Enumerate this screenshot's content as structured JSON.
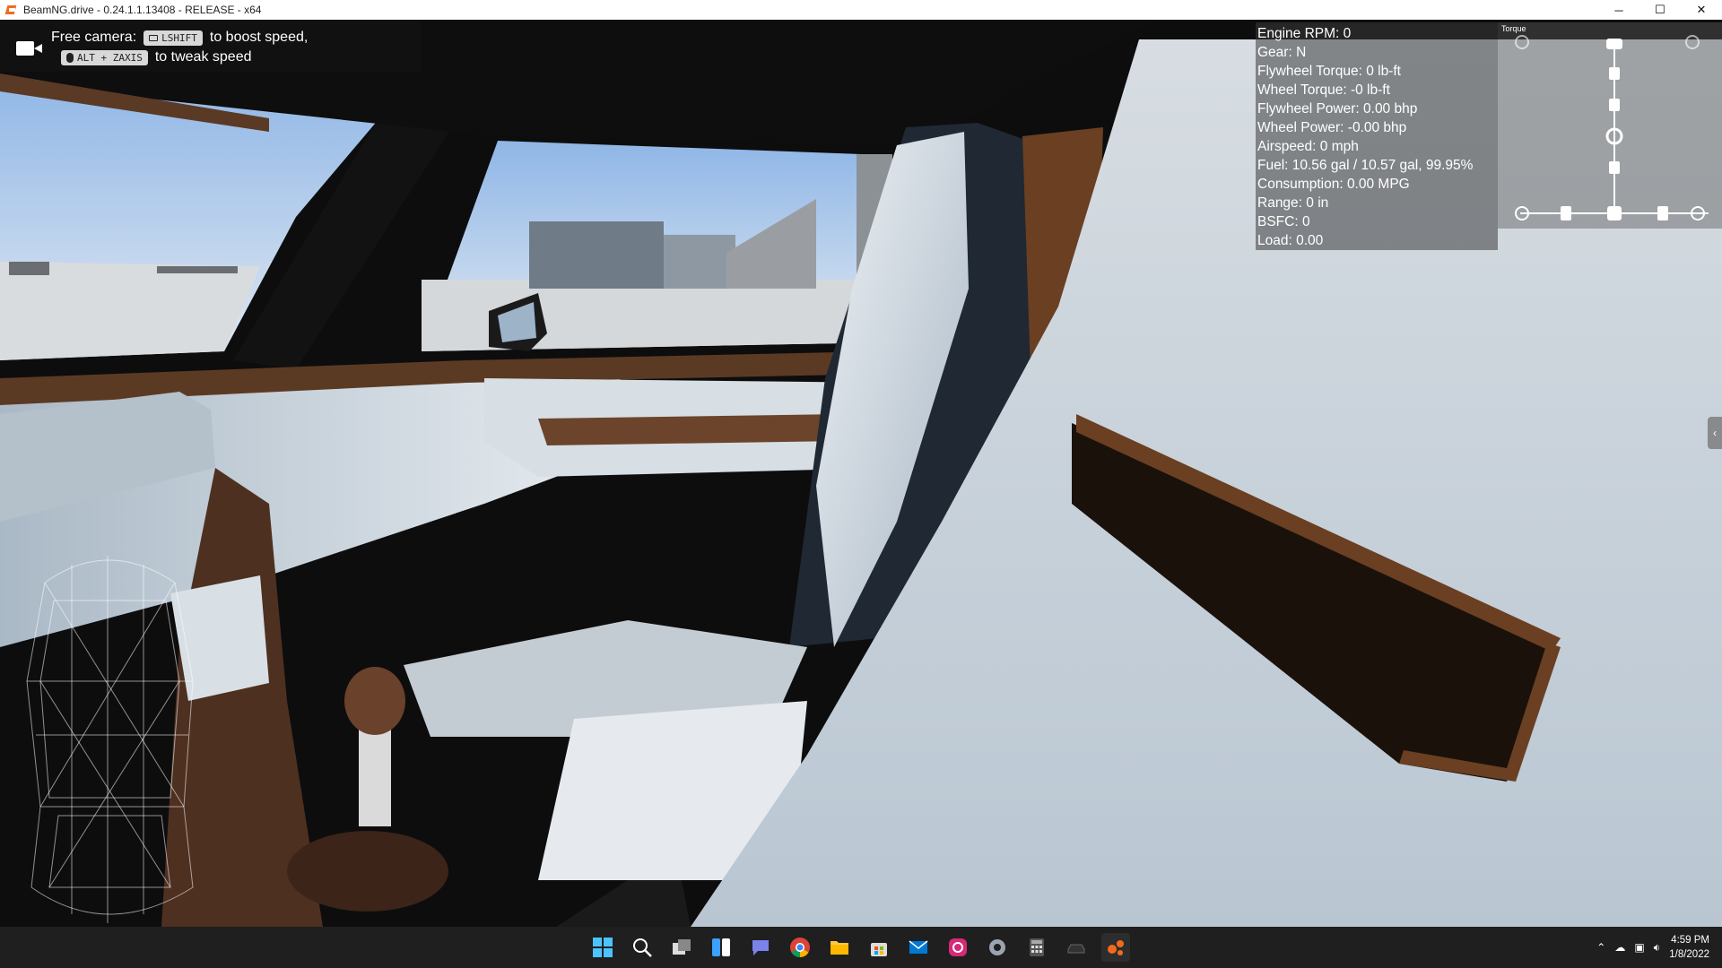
{
  "window": {
    "title": "BeamNG.drive - 0.24.1.1.13408 - RELEASE - x64",
    "minimize": "─",
    "maximize": "☐",
    "close": "✕"
  },
  "camera_hint": {
    "label": "Free camera:",
    "key1": "LSHIFT",
    "text1": "to boost speed,",
    "key2": "ALT + ZAXIS",
    "text2": "to tweak speed"
  },
  "telemetry": [
    "Engine RPM: 0",
    "Gear: N",
    "Flywheel Torque: 0 lb-ft",
    "Wheel Torque: -0 lb-ft",
    "Flywheel Power: 0.00 bhp",
    "Wheel Power: -0.00 bhp",
    "Airspeed: 0 mph",
    "Fuel: 10.56 gal / 10.57 gal, 99.95%",
    "Consumption: 0.00 MPG",
    "Range: 0 in",
    "BSFC: 0",
    "Load: 0.00"
  ],
  "powertrain": {
    "title": "Torque"
  },
  "side_tab": {
    "glyph": "‹"
  },
  "taskbar": {
    "icons": [
      "windows-start-icon",
      "search-icon",
      "task-view-icon",
      "widgets-icon",
      "teams-chat-icon",
      "chrome-icon",
      "file-explorer-icon",
      "microsoft-store-icon",
      "mail-icon",
      "instagram-icon",
      "settings-icon",
      "calculator-icon",
      "car-app-icon",
      "beamng-icon"
    ],
    "time": "4:59 PM",
    "date": "1/8/2022"
  }
}
